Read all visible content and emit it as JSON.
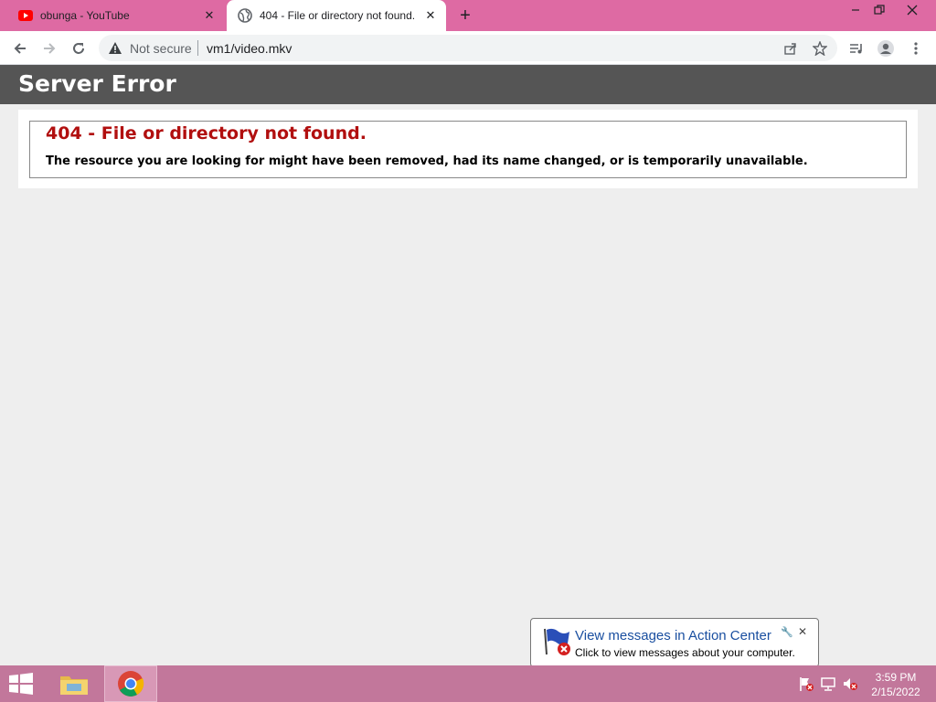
{
  "browser": {
    "tabs": [
      {
        "title": "obunga - YouTube",
        "active": false,
        "favicon": "youtube-icon"
      },
      {
        "title": "404 - File or directory not found.",
        "active": true,
        "favicon": "globe-icon"
      }
    ],
    "omnibox": {
      "security_label": "Not secure",
      "url": "vm1/video.mkv"
    }
  },
  "page": {
    "header": "Server Error",
    "error_title": "404 - File or directory not found.",
    "error_message": "The resource you are looking for might have been removed, had its name changed, or is temporarily unavailable."
  },
  "notification": {
    "title": "View messages in Action Center",
    "text": "Click to view messages about your computer."
  },
  "taskbar": {
    "time": "3:59 PM",
    "date": "2/15/2022"
  },
  "colors": {
    "tabstrip": "#de6aa3",
    "taskbar": "#c2779b",
    "page_header": "#555555",
    "error_title": "#b10f0f"
  }
}
